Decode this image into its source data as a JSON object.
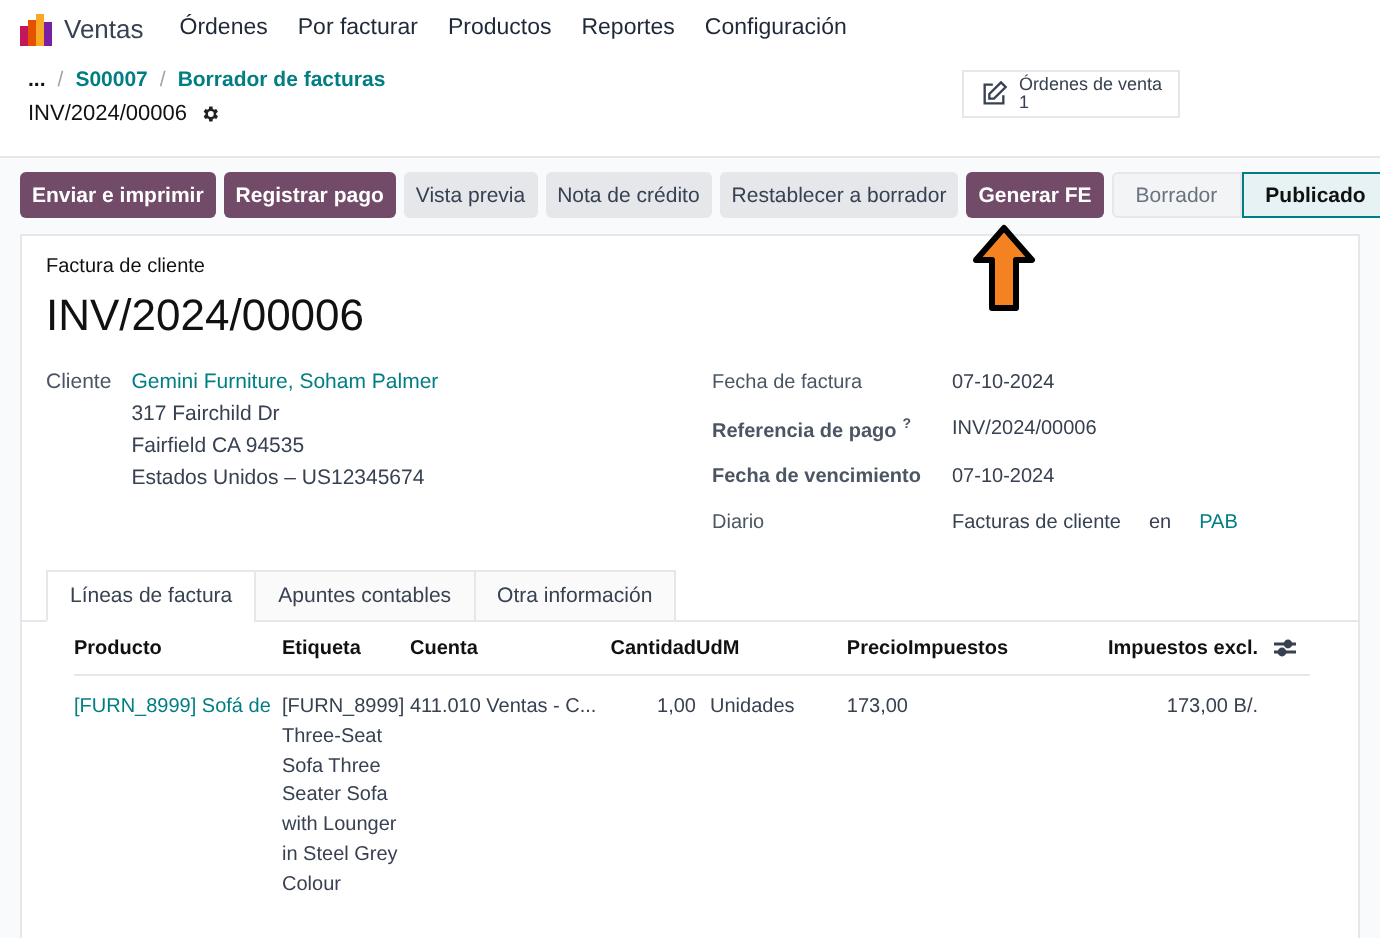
{
  "app": {
    "name": "Ventas"
  },
  "menu": [
    "Órdenes",
    "Por facturar",
    "Productos",
    "Reportes",
    "Configuración"
  ],
  "breadcrumb": {
    "more": "...",
    "separator": "/",
    "items": [
      "S00007",
      "Borrador de facturas"
    ],
    "current": "INV/2024/00006"
  },
  "smart_button": {
    "label": "Órdenes de venta",
    "count": "1"
  },
  "actions": [
    {
      "label": "Enviar e imprimir",
      "kind": "primary"
    },
    {
      "label": "Registrar pago",
      "kind": "primary"
    },
    {
      "label": "Vista previa",
      "kind": "secondary"
    },
    {
      "label": "Nota de crédito",
      "kind": "secondary"
    },
    {
      "label": "Restablecer a borrador",
      "kind": "secondary"
    },
    {
      "label": "Generar FE",
      "kind": "primary"
    }
  ],
  "status_steps": [
    {
      "label": "Borrador",
      "selected": false
    },
    {
      "label": "Publicado",
      "selected": true
    }
  ],
  "invoice": {
    "type_label": "Factura de cliente",
    "number": "INV/2024/00006",
    "customer_label": "Cliente",
    "customer_name": "Gemini Furniture, Soham Palmer",
    "address_lines": [
      "317 Fairchild Dr",
      "Fairfield CA 94535",
      "Estados Unidos – US12345674"
    ],
    "fields": [
      {
        "kind": "text",
        "label": "Fecha de factura",
        "bold": false,
        "value": "07-10-2024"
      },
      {
        "kind": "text",
        "label": "Referencia de pago",
        "bold": true,
        "help": "?",
        "value": "INV/2024/00006"
      },
      {
        "kind": "text",
        "label": "Fecha de vencimiento",
        "bold": true,
        "value": "07-10-2024"
      },
      {
        "kind": "journal",
        "label": "Diario",
        "bold": false,
        "value": "Facturas de cliente",
        "connector": "en",
        "link": "PAB"
      }
    ]
  },
  "tabs": [
    {
      "label": "Líneas de factura",
      "selected": true
    },
    {
      "label": "Apuntes contables",
      "selected": false
    },
    {
      "label": "Otra información",
      "selected": false
    }
  ],
  "table": {
    "columns": [
      "Producto",
      "Etiqueta",
      "Cuenta",
      "Cantidad",
      "UdM",
      "Precio",
      "Impuestos",
      "Impuestos excl."
    ],
    "rows": [
      {
        "product": "[FURN_8999] Sofá de",
        "label": "[FURN_8999] Three-Seat Sofa Three Seater Sofa with Lounger in Steel Grey Colour",
        "account": "411.010 Ventas - C...",
        "quantity": "1,00",
        "uom": "Unidades",
        "price": "173,00",
        "subtotal": "173,00 B/."
      }
    ]
  }
}
